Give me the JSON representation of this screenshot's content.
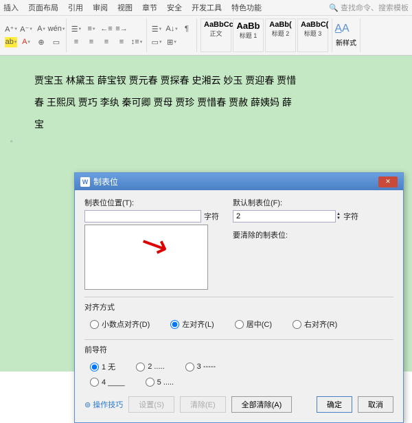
{
  "menu": [
    "插入",
    "页面布局",
    "引用",
    "审阅",
    "视图",
    "章节",
    "安全",
    "开发工具",
    "特色功能"
  ],
  "search": {
    "placeholder": "查找命令、搜索模板"
  },
  "styles": [
    {
      "prev": "AaBbCc",
      "name": "正文"
    },
    {
      "prev": "AaBb",
      "name": "标题 1"
    },
    {
      "prev": "AaBb(",
      "name": "标题 2"
    },
    {
      "prev": "AaBbC(",
      "name": "标题 3"
    }
  ],
  "new_style": "新样式",
  "doc_lines": [
    "贾宝玉  林黛玉  薛宝钗  贾元春  贾探春  史湘云  妙玉  贾迎春  贾惜",
    "春  王熙凤  贾巧  李纨  秦可卿  贾母  贾珍  贾惜春  贾赦  薛姨妈  薛",
    "宝"
  ],
  "dialog": {
    "title": "制表位",
    "pos_label": "制表位位置(T):",
    "default_label": "默认制表位(F):",
    "default_value": "2",
    "unit": "字符",
    "clear_label": "要清除的制表位:",
    "align_title": "对齐方式",
    "align_opts": [
      "小数点对齐(D)",
      "左对齐(L)",
      "居中(C)",
      "右对齐(R)"
    ],
    "align_sel": 1,
    "leader_title": "前导符",
    "leader_opts": [
      "1 无",
      "2 .....",
      "3 -----",
      "4 ____",
      "5 ....."
    ],
    "leader_sel": 0,
    "tip": "操作技巧",
    "btn_set": "设置(S)",
    "btn_clear": "清除(E)",
    "btn_clear_all": "全部清除(A)",
    "btn_ok": "确定",
    "btn_cancel": "取消"
  }
}
